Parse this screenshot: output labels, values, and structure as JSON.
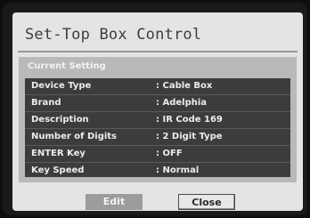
{
  "dialog": {
    "title": "Set-Top Box Control"
  },
  "panel": {
    "header": "Current Setting",
    "rows": [
      {
        "label": "Device Type",
        "value": ": Cable Box"
      },
      {
        "label": "Brand",
        "value": ": Adelphia"
      },
      {
        "label": "Description",
        "value": ": IR Code 169"
      },
      {
        "label": "Number of Digits",
        "value": ": 2 Digit Type"
      },
      {
        "label": "ENTER Key",
        "value": ": OFF"
      },
      {
        "label": "Key Speed",
        "value": ": Normal"
      }
    ]
  },
  "buttons": {
    "edit_label": "Edit",
    "close_label": "Close",
    "focused": "close"
  },
  "colors": {
    "dialog_bg": "#e4e4e4",
    "table_bg": "#3c3c3c",
    "panel_bg": "#b9b9b9"
  }
}
